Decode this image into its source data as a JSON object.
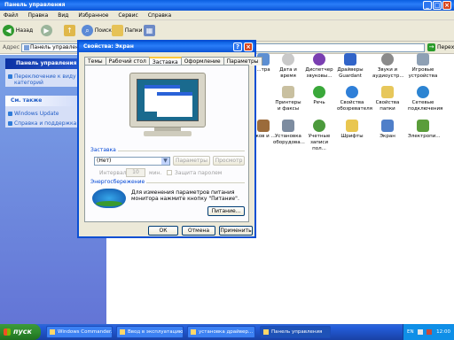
{
  "explorer": {
    "title": "Панель управления",
    "menu": [
      "Файл",
      "Правка",
      "Вид",
      "Избранное",
      "Сервис",
      "Справка"
    ],
    "toolbar": {
      "back": "Назад",
      "search": "Поиск",
      "folders": "Папки"
    },
    "address": {
      "label": "Адрес",
      "value": "Панель управления",
      "go": "Переход"
    }
  },
  "taskpane": {
    "cp_title": "Панель управления",
    "switch_link": "Переключение к виду категорий",
    "see_also_title": "См. также",
    "links": [
      "Windows Update",
      "Справка и поддержка"
    ]
  },
  "icons": {
    "row1": [
      "Дата и время",
      "Диспетчер звуковы...",
      "Драйверы Guardant",
      "Звуки и аудиоустр...",
      "Игровые устройства"
    ],
    "row2": [
      "Принтеры и факсы",
      "Речь",
      "Свойства обозревателя",
      "Свойства папки",
      "Сетевые подключения"
    ],
    "row3": [
      "Установка оборудова...",
      "Учетные записи пол...",
      "Шрифты",
      "Экран",
      "Электропи..."
    ],
    "partial": [
      "...тра",
      "...ков и ...",
      "..."
    ]
  },
  "dialog": {
    "title": "Свойства: Экран",
    "tabs": [
      "Темы",
      "Рабочий стол",
      "Заставка",
      "Оформление",
      "Параметры"
    ],
    "screensaver_group": "Заставка",
    "screensaver_value": "(Нет)",
    "params_button": "Параметры",
    "preview_button": "Просмотр",
    "interval_label": "Интервал:",
    "interval_value": "10",
    "interval_unit": "мин.",
    "password_label": "Защита паролем",
    "energy_group": "Энергосбережение",
    "energy_text": "Для изменения параметров питания монитора нажмите кнопку \"Питание\".",
    "power_button": "Питание...",
    "ok": "ОК",
    "cancel": "Отмена",
    "apply": "Применить"
  },
  "taskbar": {
    "start": "пуск",
    "tasks": [
      "Windows Commander...",
      "Ввод в эксплуатацию...",
      "установка драйвер...",
      "Панель управления"
    ],
    "lang": "EN",
    "clock": "12:00"
  }
}
